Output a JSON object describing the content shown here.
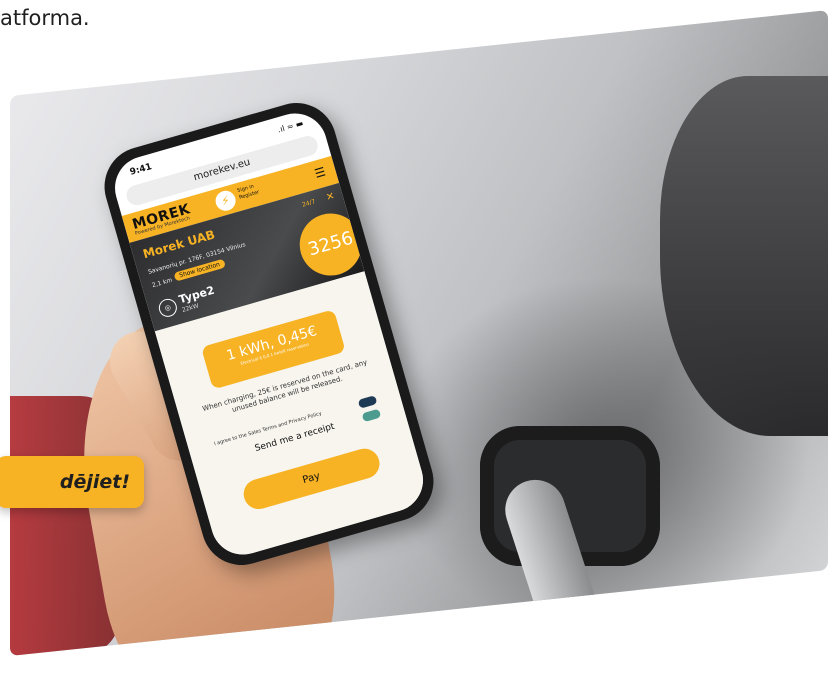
{
  "intro_text": "atforma.",
  "badge_text": "dējiet!",
  "phone": {
    "time": "9:41",
    "status_icons": ".ıl ≈ ▬",
    "url": "morekev.eu",
    "logo": "MOREK",
    "logo_sub": "Powered by Morektech",
    "sign_in": "Sign in",
    "register": "Register",
    "station_name": "Morek UAB",
    "availability": "24/7",
    "address": "Savanorių pr. 176F, 03154 Vilnius",
    "distance": "2,1 km",
    "show_location": "Show location",
    "connector_type": "Type2",
    "power": "22kW",
    "station_code": "3256",
    "price": "1 kWh, 0,45€",
    "price_sub": "Electrical $ 0,0 1 kwh/€ reservation",
    "charging_note": "When charging, 25€ is reserved on the card, any unused balance will be released.",
    "agree_text": "I agree to the Sales Terms and Privacy Policy",
    "receipt_label": "Send me a receipt",
    "pay_label": "Pay"
  },
  "colors": {
    "accent": "#f7b324",
    "dark": "#1a1a1b"
  }
}
